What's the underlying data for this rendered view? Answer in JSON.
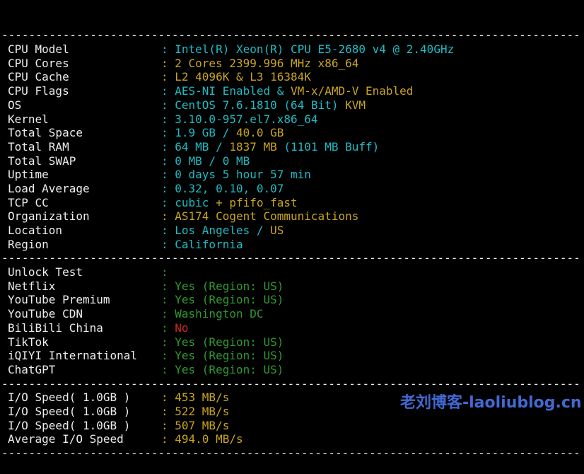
{
  "terminal": {
    "background": "#000000",
    "colors": {
      "label": "#ededed",
      "separator": "#ededed",
      "cyan": "#1cbcc4",
      "yellow": "#c9a51e",
      "green": "#2e9b2e",
      "red": "#cd2828"
    },
    "separator_text": "-------------------------------------------------------------------------------------",
    "lines": [
      {
        "sep": true
      },
      {
        "label": "CPU Model",
        "segs": [
          {
            "c": "cyan",
            "t": ": Intel(R) Xeon(R) CPU E5-2680 v4 @ 2.40GHz"
          }
        ]
      },
      {
        "label": "CPU Cores",
        "segs": [
          {
            "c": "yellow",
            "t": ": 2 Cores 2399.996 MHz x86_64"
          }
        ]
      },
      {
        "label": "CPU Cache",
        "segs": [
          {
            "c": "yellow",
            "t": ": L2 4096K & L3 16384K"
          }
        ]
      },
      {
        "label": "CPU Flags",
        "segs": [
          {
            "c": "cyan",
            "t": ": AES-NI Enabled & "
          },
          {
            "c": "yellow",
            "t": "VM-x/AMD-V Enabled"
          }
        ]
      },
      {
        "label": "OS",
        "segs": [
          {
            "c": "cyan",
            "t": ": CentOS 7.6.1810 (64 Bit) "
          },
          {
            "c": "yellow",
            "t": "KVM"
          }
        ]
      },
      {
        "label": "Kernel",
        "segs": [
          {
            "c": "cyan",
            "t": ": 3.10.0-957.el7.x86_64"
          }
        ]
      },
      {
        "label": "Total Space",
        "segs": [
          {
            "c": "cyan",
            "t": ": 1.9 GB / "
          },
          {
            "c": "yellow",
            "t": "40.0 GB"
          }
        ]
      },
      {
        "label": "Total RAM",
        "segs": [
          {
            "c": "cyan",
            "t": ": 64 MB / "
          },
          {
            "c": "yellow",
            "t": "1837 MB"
          },
          {
            "c": "cyan",
            "t": " (1101 MB Buff)"
          }
        ]
      },
      {
        "label": "Total SWAP",
        "segs": [
          {
            "c": "cyan",
            "t": ": 0 MB / 0 MB"
          }
        ]
      },
      {
        "label": "Uptime",
        "segs": [
          {
            "c": "cyan",
            "t": ": 0 days 5 hour 57 min"
          }
        ]
      },
      {
        "label": "Load Average",
        "segs": [
          {
            "c": "cyan",
            "t": ": 0.32, 0.10, 0.07"
          }
        ]
      },
      {
        "label": "TCP CC",
        "segs": [
          {
            "c": "cyan",
            "t": ": cubic"
          },
          {
            "c": "yellow",
            "t": " + pfifo_fast"
          }
        ]
      },
      {
        "label": "Organization",
        "segs": [
          {
            "c": "yellow",
            "t": ": AS174 Cogent Communications"
          }
        ]
      },
      {
        "label": "Location",
        "segs": [
          {
            "c": "cyan",
            "t": ": Los Angeles / "
          },
          {
            "c": "yellow",
            "t": "US"
          }
        ]
      },
      {
        "label": "Region",
        "segs": [
          {
            "c": "cyan",
            "t": ": California"
          }
        ]
      },
      {
        "sep": true
      },
      {
        "label": "Unlock Test",
        "segs": [
          {
            "c": "green",
            "t": ":"
          }
        ]
      },
      {
        "label": "Netflix",
        "segs": [
          {
            "c": "green",
            "t": ": Yes (Region: US)"
          }
        ]
      },
      {
        "label": "YouTube Premium",
        "segs": [
          {
            "c": "green",
            "t": ": Yes (Region: US)"
          }
        ]
      },
      {
        "label": "YouTube CDN",
        "segs": [
          {
            "c": "green",
            "t": ": Washington DC"
          }
        ]
      },
      {
        "label": "BiliBili China",
        "segs": [
          {
            "c": "green",
            "t": ": "
          },
          {
            "c": "red",
            "t": "No"
          }
        ]
      },
      {
        "label": "TikTok",
        "segs": [
          {
            "c": "green",
            "t": ": Yes (Region: US)"
          }
        ]
      },
      {
        "label": "iQIYI International",
        "segs": [
          {
            "c": "green",
            "t": ": Yes (Region: US)"
          }
        ]
      },
      {
        "label": "ChatGPT",
        "segs": [
          {
            "c": "green",
            "t": ": Yes (Region: US)"
          }
        ]
      },
      {
        "sep": true
      },
      {
        "label": "I/O Speed( 1.0GB )",
        "segs": [
          {
            "c": "yellow",
            "t": ": 453 MB/s"
          }
        ]
      },
      {
        "label": "I/O Speed( 1.0GB )",
        "segs": [
          {
            "c": "yellow",
            "t": ": 522 MB/s"
          }
        ]
      },
      {
        "label": "I/O Speed( 1.0GB )",
        "segs": [
          {
            "c": "yellow",
            "t": ": 507 MB/s"
          }
        ]
      },
      {
        "label": "Average I/O Speed",
        "segs": [
          {
            "c": "yellow",
            "t": ": 494.0 MB/s"
          }
        ]
      },
      {
        "sep": true
      }
    ]
  },
  "watermark": {
    "text": "老刘博客-laoliublog.cn",
    "color": "#4169d2"
  }
}
